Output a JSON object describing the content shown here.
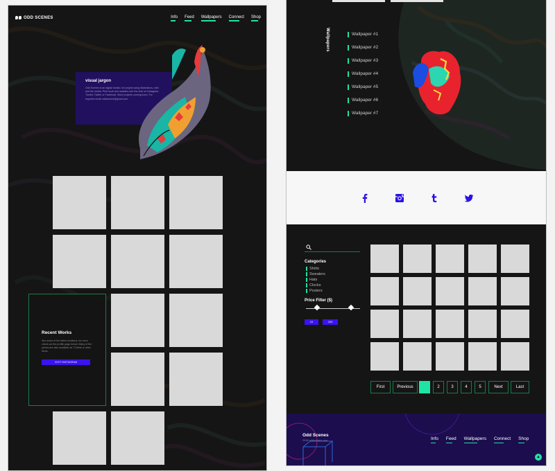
{
  "nav": {
    "brand": "ODD SCENES",
    "items": [
      "Info",
      "Feed",
      "Wallpapers",
      "Connect",
      "Shop"
    ]
  },
  "about": {
    "title": "visual jargon",
    "body": "Odd Scenes is an digital media / art project using illustrations, web and the media. Print work and updates over the web on Instagram, Tumblr, Twitter or Facebook. More projects coming soon. For inquiries email oddscenes@gmail.com"
  },
  "recent": {
    "title": "Recent Works",
    "body": "See some of the latest creations, for more check out the profile page below. Many of the pieces are also available as T-Shirts or other items.",
    "button": "VISIT INSTAGRAM"
  },
  "wallpapers": {
    "title": "Wallpapers",
    "items": [
      "Wallpaper #1",
      "Wallpaper #2",
      "Wallpaper #3",
      "Wallpaper #4",
      "Wallpaper #5",
      "Wallpaper #6",
      "Wallpaper #7"
    ]
  },
  "social": {
    "icons": [
      "facebook-icon",
      "instagram-icon",
      "tumblr-icon",
      "twitter-icon"
    ],
    "color": "#2b12e6"
  },
  "shop": {
    "categories_title": "Categories",
    "categories": [
      "Shirts",
      "Sweaters",
      "Hats",
      "Clocks",
      "Posters"
    ],
    "price_filter_title": "Price Filter ($)",
    "price_min": "10",
    "price_max": "200",
    "pagination": [
      "First",
      "Previous",
      "1",
      "2",
      "3",
      "4",
      "5",
      "Next",
      "Last"
    ],
    "current_page": "1"
  },
  "footer": {
    "brand": "Odd Scenes",
    "sub": "2018 oddscenes.com",
    "items": [
      "Info",
      "Feed",
      "Wallpapers",
      "Connect",
      "Shop"
    ]
  },
  "colors": {
    "accent": "#1fe3a4",
    "brand_purple": "#3b12f2",
    "footer_bg": "#1c0d4e",
    "panel_bg": "#151515"
  }
}
